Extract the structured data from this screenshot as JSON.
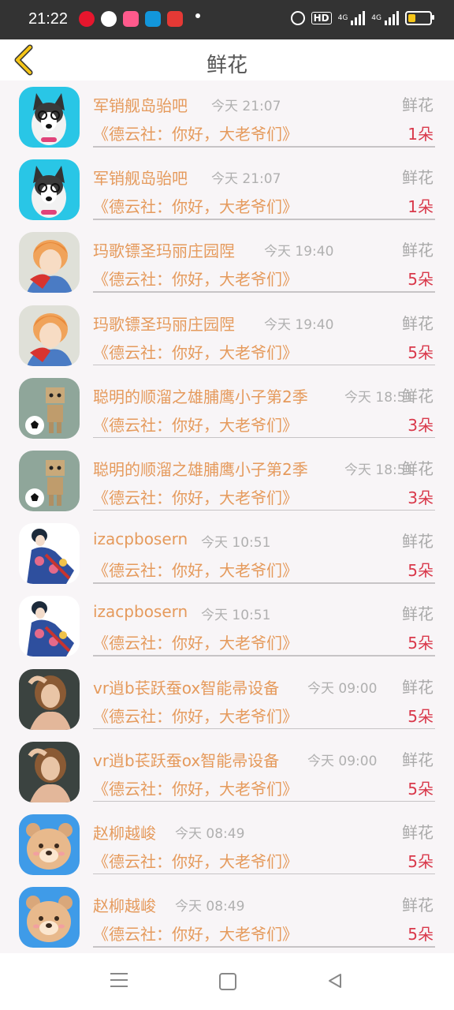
{
  "status_bar": {
    "time": "21:22",
    "hd": "HD",
    "net1": "4G",
    "net2": "4G",
    "icons": [
      "weibo-icon",
      "wechat-icon",
      "app-icon",
      "app-icon",
      "app-icon",
      "alarm-icon",
      "signal-icon",
      "battery-icon"
    ]
  },
  "header": {
    "title": "鲜花"
  },
  "messages": [
    {
      "name": "军销舰岛骀吧",
      "time": "今天 21:07",
      "gift_label": "鲜花",
      "message": "《德云社：你好，大老爷们》",
      "count": "1朵",
      "avatar": "husky-avatar"
    },
    {
      "name": "军销舰岛骀吧",
      "time": "今天 21:07",
      "gift_label": "鲜花",
      "message": "《德云社：你好，大老爷们》",
      "count": "1朵",
      "avatar": "husky-avatar"
    },
    {
      "name": "玛歌镖圣玛丽庄园陧",
      "time": "今天 19:40",
      "gift_label": "鲜花",
      "message": "《德云社：你好，大老爷们》",
      "count": "5朵",
      "avatar": "anime-boy-avatar"
    },
    {
      "name": "玛歌镖圣玛丽庄园陧",
      "time": "今天 19:40",
      "gift_label": "鲜花",
      "message": "《德云社：你好，大老爷们》",
      "count": "5朵",
      "avatar": "anime-boy-avatar"
    },
    {
      "name": "聪明的顺溜之雄脯鹰小子第2季",
      "time": "今天 18:51",
      "gift_label": "鲜花",
      "message": "《德云社：你好，大老爷们》",
      "count": "3朵",
      "avatar": "danbo-avatar"
    },
    {
      "name": "聪明的顺溜之雄脯鹰小子第2季",
      "time": "今天 18:51",
      "gift_label": "鲜花",
      "message": "《德云社：你好，大老爷们》",
      "count": "3朵",
      "avatar": "danbo-avatar"
    },
    {
      "name": "izacpbosern",
      "time": "今天 10:51",
      "gift_label": "鲜花",
      "message": "《德云社：你好，大老爷们》",
      "count": "5朵",
      "avatar": "kimono-avatar"
    },
    {
      "name": "izacpbosern",
      "time": "今天 10:51",
      "gift_label": "鲜花",
      "message": "《德云社：你好，大老爷们》",
      "count": "5朵",
      "avatar": "kimono-avatar"
    },
    {
      "name": "vr逍b苌跃蚕ox智能帚设备",
      "time": "今天 09:00",
      "gift_label": "鲜花",
      "message": "《德云社：你好，大老爷们》",
      "count": "5朵",
      "avatar": "portrait-avatar"
    },
    {
      "name": "vr逍b苌跃蚕ox智能帚设备",
      "time": "今天 09:00",
      "gift_label": "鲜花",
      "message": "《德云社：你好，大老爷们》",
      "count": "5朵",
      "avatar": "portrait-avatar"
    },
    {
      "name": "赵柳越峻",
      "time": "今天 08:49",
      "gift_label": "鲜花",
      "message": "《德云社：你好，大老爷们》",
      "count": "5朵",
      "avatar": "bear-avatar"
    },
    {
      "name": "赵柳越峻",
      "time": "今天 08:49",
      "gift_label": "鲜花",
      "message": "《德云社：你好，大老爷们》",
      "count": "5朵",
      "avatar": "bear-avatar"
    }
  ],
  "colors": {
    "name": "#e59a5c",
    "count": "#d9394b",
    "muted": "#b0b0b0",
    "background": "#f8f5f7"
  }
}
